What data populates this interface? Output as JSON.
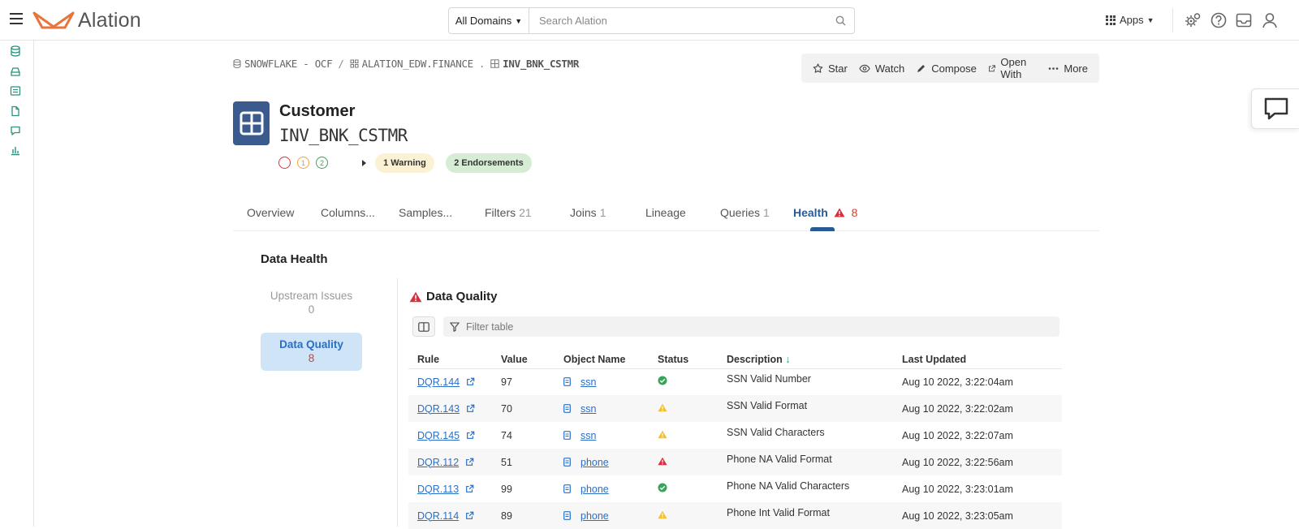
{
  "topbar": {
    "brand": "Alation",
    "domains_label": "All Domains",
    "search_placeholder": "Search Alation",
    "apps_label": "Apps"
  },
  "breadcrumb": {
    "items": [
      "SNOWFLAKE - OCF",
      "ALATION_EDW.FINANCE",
      "INV_BNK_CSTMR"
    ],
    "separators": [
      "/",
      "."
    ]
  },
  "actions": [
    {
      "label": "Star",
      "icon": "star-icon"
    },
    {
      "label": "Watch",
      "icon": "eye-icon"
    },
    {
      "label": "Compose",
      "icon": "pen-icon"
    },
    {
      "label": "Open With",
      "icon": "external-link-icon"
    },
    {
      "label": "More",
      "icon": "ellipsis-icon"
    }
  ],
  "object": {
    "title": "Customer",
    "name": "INV_BNK_CSTMR",
    "trust_flags": {
      "warning": "1",
      "endorsement": "2"
    },
    "pills": {
      "warning": "1 Warning",
      "endorsements": "2 Endorsements"
    }
  },
  "tabs": [
    {
      "label": "Overview",
      "count": ""
    },
    {
      "label": "Columns...",
      "count": ""
    },
    {
      "label": "Samples...",
      "count": ""
    },
    {
      "label": "Filters",
      "count": "21"
    },
    {
      "label": "Joins",
      "count": "1"
    },
    {
      "label": "Lineage",
      "count": ""
    },
    {
      "label": "Queries",
      "count": "1"
    },
    {
      "label": "Health",
      "count": "8",
      "active": true
    }
  ],
  "health": {
    "title": "Data Health",
    "side": [
      {
        "label": "Upstream Issues",
        "count": "0"
      },
      {
        "label": "Data Quality",
        "count": "8"
      }
    ],
    "section_title": "Data Quality",
    "filter_placeholder": "Filter table",
    "columns": [
      "Rule",
      "Value",
      "Object Name",
      "Status",
      "Description",
      "Last Updated"
    ],
    "rows": [
      {
        "rule": "DQR.144",
        "value": "97",
        "object": "ssn",
        "status": "ok",
        "description": "SSN Valid Number",
        "updated": "Aug 10 2022, 3:22:04am"
      },
      {
        "rule": "DQR.143",
        "value": "70",
        "object": "ssn",
        "status": "warning",
        "description": "SSN Valid Format",
        "updated": "Aug 10 2022, 3:22:02am"
      },
      {
        "rule": "DQR.145",
        "value": "74",
        "object": "ssn",
        "status": "warning",
        "description": "SSN Valid Characters",
        "updated": "Aug 10 2022, 3:22:07am"
      },
      {
        "rule": "DQR.112",
        "value": "51",
        "object": "phone",
        "status": "alert",
        "description": "Phone NA Valid Format",
        "updated": "Aug 10 2022, 3:22:56am"
      },
      {
        "rule": "DQR.113",
        "value": "99",
        "object": "phone",
        "status": "ok",
        "description": "Phone NA Valid Characters",
        "updated": "Aug 10 2022, 3:23:01am"
      },
      {
        "rule": "DQR.114",
        "value": "89",
        "object": "phone",
        "status": "warning",
        "description": "Phone Int Valid Format",
        "updated": "Aug 10 2022, 3:23:05am"
      }
    ]
  },
  "colors": {
    "accent": "#2a5a96",
    "link": "#2a6fc6",
    "brand_orange": "#e8743b",
    "status_ok": "#3aa35a",
    "status_warning": "#f2c12e",
    "status_alert": "#d9303f"
  }
}
